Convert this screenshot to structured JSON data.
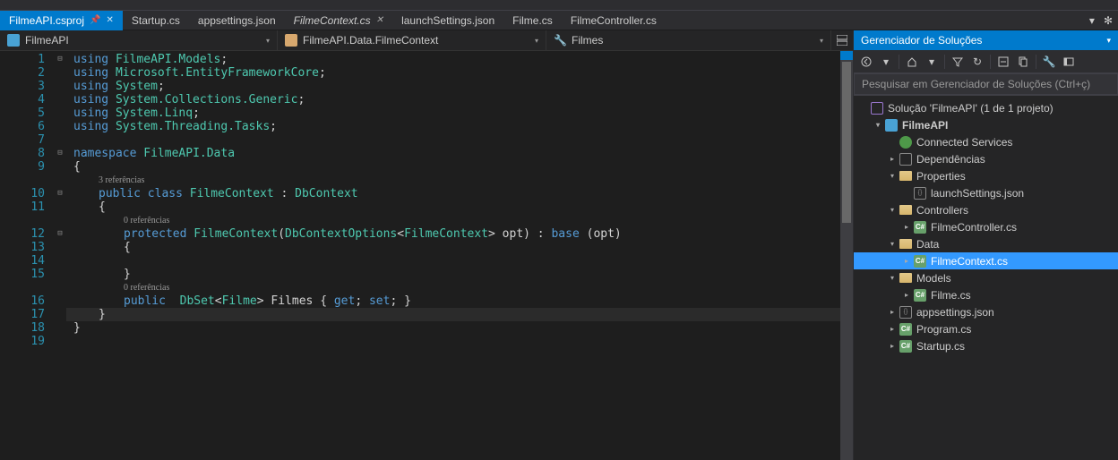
{
  "tabs": [
    {
      "label": "FilmeAPI.csproj",
      "active": true,
      "pinned": true
    },
    {
      "label": "Startup.cs"
    },
    {
      "label": "appsettings.json"
    },
    {
      "label": "FilmeContext.cs",
      "preview": true,
      "closeable": true
    },
    {
      "label": "launchSettings.json"
    },
    {
      "label": "Filme.cs"
    },
    {
      "label": "FilmeController.cs"
    }
  ],
  "navbar": {
    "project": "FilmeAPI",
    "scope": "FilmeAPI.Data.FilmeContext",
    "member": "Filmes"
  },
  "code": {
    "lines": [
      {
        "n": 1,
        "i": 0,
        "seg": [
          [
            "kw",
            "using "
          ],
          [
            "ns",
            "FilmeAPI.Models"
          ],
          [
            "punc",
            ";"
          ]
        ]
      },
      {
        "n": 2,
        "i": 0,
        "seg": [
          [
            "kw",
            "using "
          ],
          [
            "ns",
            "Microsoft.EntityFrameworkCore"
          ],
          [
            "punc",
            ";"
          ]
        ]
      },
      {
        "n": 3,
        "i": 0,
        "seg": [
          [
            "kw",
            "using "
          ],
          [
            "ns",
            "System"
          ],
          [
            "punc",
            ";"
          ]
        ]
      },
      {
        "n": 4,
        "i": 0,
        "seg": [
          [
            "kw",
            "using "
          ],
          [
            "ns",
            "System.Collections.Generic"
          ],
          [
            "punc",
            ";"
          ]
        ]
      },
      {
        "n": 5,
        "i": 0,
        "seg": [
          [
            "kw",
            "using "
          ],
          [
            "ns",
            "System.Linq"
          ],
          [
            "punc",
            ";"
          ]
        ]
      },
      {
        "n": 6,
        "i": 0,
        "seg": [
          [
            "kw",
            "using "
          ],
          [
            "ns",
            "System.Threading.Tasks"
          ],
          [
            "punc",
            ";"
          ]
        ]
      },
      {
        "n": 7,
        "i": 0,
        "seg": []
      },
      {
        "n": 8,
        "i": 0,
        "seg": [
          [
            "kw",
            "namespace "
          ],
          [
            "ns",
            "FilmeAPI.Data"
          ]
        ]
      },
      {
        "n": 9,
        "i": 0,
        "seg": [
          [
            "punc",
            "{"
          ]
        ]
      },
      {
        "lens": "3 referências",
        "i": 1
      },
      {
        "n": 10,
        "i": 1,
        "seg": [
          [
            "kw",
            "public class "
          ],
          [
            "cls",
            "FilmeContext"
          ],
          [
            "pln",
            " : "
          ],
          [
            "cls",
            "DbContext"
          ]
        ]
      },
      {
        "n": 11,
        "i": 1,
        "seg": [
          [
            "punc",
            "{"
          ]
        ]
      },
      {
        "lens": "0 referências",
        "i": 2
      },
      {
        "n": 12,
        "i": 2,
        "seg": [
          [
            "kw",
            "protected "
          ],
          [
            "cls",
            "FilmeContext"
          ],
          [
            "punc",
            "("
          ],
          [
            "cls",
            "DbContextOptions"
          ],
          [
            "punc",
            "<"
          ],
          [
            "cls",
            "FilmeContext"
          ],
          [
            "punc",
            "> "
          ],
          [
            "pln",
            "opt"
          ],
          [
            "punc",
            ") : "
          ],
          [
            "kw",
            "base "
          ],
          [
            "punc",
            "("
          ],
          [
            "pln",
            "opt"
          ],
          [
            "punc",
            ")"
          ]
        ]
      },
      {
        "n": 13,
        "i": 2,
        "seg": [
          [
            "punc",
            "{"
          ]
        ]
      },
      {
        "n": 14,
        "i": 2,
        "seg": []
      },
      {
        "n": 15,
        "i": 2,
        "seg": [
          [
            "punc",
            "}"
          ]
        ]
      },
      {
        "lens": "0 referências",
        "i": 2
      },
      {
        "n": 16,
        "i": 2,
        "seg": [
          [
            "kw",
            "public  "
          ],
          [
            "cls",
            "DbSet"
          ],
          [
            "punc",
            "<"
          ],
          [
            "cls",
            "Filme"
          ],
          [
            "punc",
            "> "
          ],
          [
            "pln",
            "Filmes "
          ],
          [
            "punc",
            "{ "
          ],
          [
            "kw",
            "get"
          ],
          [
            "punc",
            "; "
          ],
          [
            "kw",
            "set"
          ],
          [
            "punc",
            "; }"
          ]
        ]
      },
      {
        "n": 17,
        "i": 1,
        "hl": true,
        "seg": [
          [
            "punc",
            "}"
          ]
        ]
      },
      {
        "n": 18,
        "i": 0,
        "seg": [
          [
            "punc",
            "}"
          ]
        ]
      },
      {
        "n": 19,
        "i": 0,
        "seg": []
      }
    ],
    "fold_hints": {
      "1": "⊟",
      "8": "⊟",
      "10": "⊟",
      "12": "⊟"
    }
  },
  "solution_explorer": {
    "title": "Gerenciador de Soluções",
    "search_placeholder": "Pesquisar em Gerenciador de Soluções (Ctrl+ç)",
    "tree": [
      {
        "d": 0,
        "exp": "",
        "icon": "sln",
        "label": "Solução 'FilmeAPI' (1 de 1 projeto)"
      },
      {
        "d": 1,
        "exp": "▾",
        "icon": "proj",
        "label": "FilmeAPI",
        "bold": true
      },
      {
        "d": 2,
        "exp": "",
        "icon": "plug",
        "label": "Connected Services"
      },
      {
        "d": 2,
        "exp": "▸",
        "icon": "dep",
        "label": "Dependências"
      },
      {
        "d": 2,
        "exp": "▾",
        "icon": "folder-open",
        "label": "Properties"
      },
      {
        "d": 3,
        "exp": "",
        "icon": "json",
        "label": "launchSettings.json"
      },
      {
        "d": 2,
        "exp": "▾",
        "icon": "folder-open",
        "label": "Controllers"
      },
      {
        "d": 3,
        "exp": "▸",
        "icon": "cs",
        "label": "FilmeController.cs"
      },
      {
        "d": 2,
        "exp": "▾",
        "icon": "folder-open",
        "label": "Data"
      },
      {
        "d": 3,
        "exp": "▸",
        "icon": "cs",
        "label": "FilmeContext.cs",
        "selected": true
      },
      {
        "d": 2,
        "exp": "▾",
        "icon": "folder-open",
        "label": "Models"
      },
      {
        "d": 3,
        "exp": "▸",
        "icon": "cs",
        "label": "Filme.cs"
      },
      {
        "d": 2,
        "exp": "▸",
        "icon": "json",
        "label": "appsettings.json"
      },
      {
        "d": 2,
        "exp": "▸",
        "icon": "cs",
        "label": "Program.cs"
      },
      {
        "d": 2,
        "exp": "▸",
        "icon": "cs",
        "label": "Startup.cs"
      }
    ]
  }
}
